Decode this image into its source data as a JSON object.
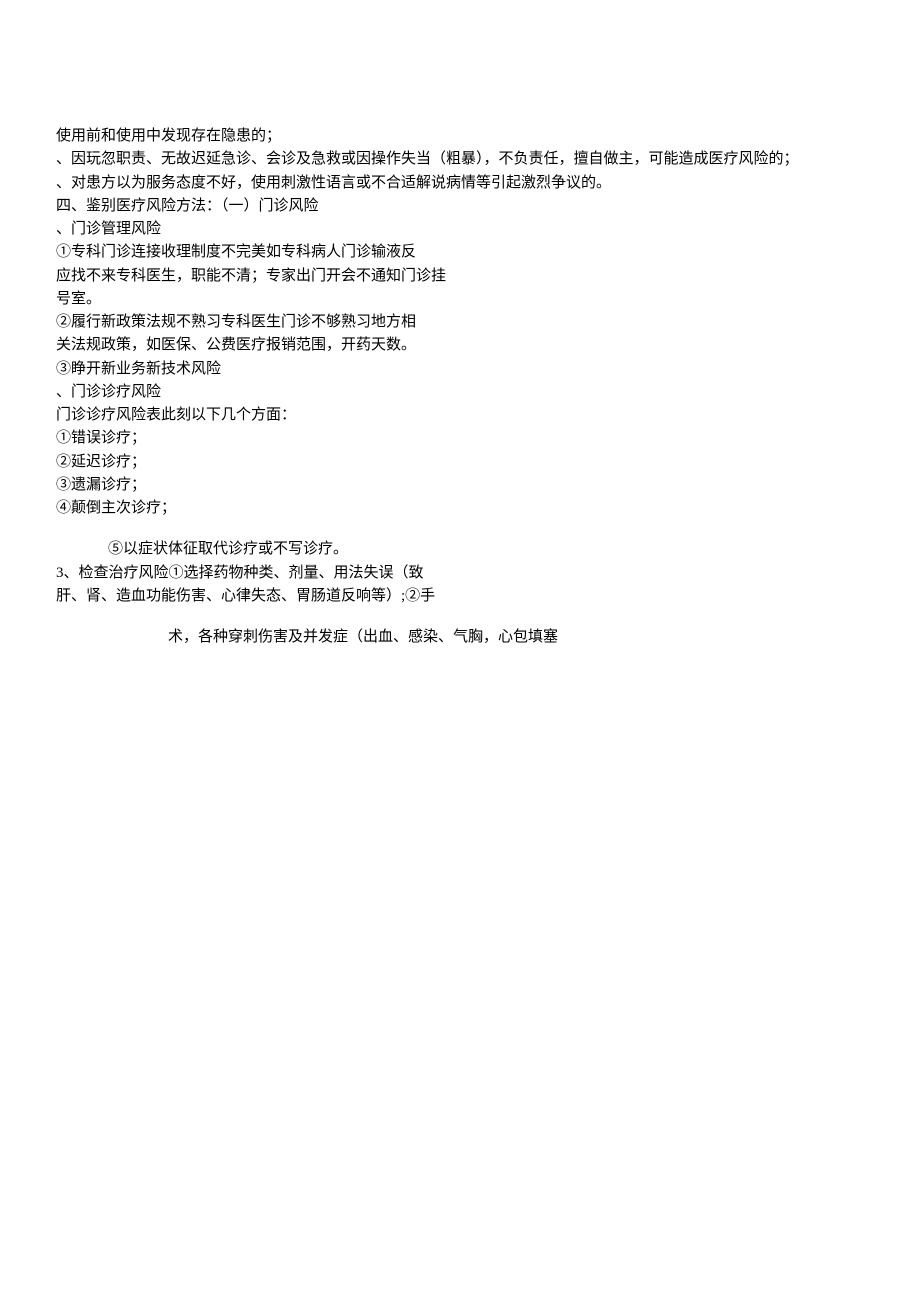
{
  "lines": {
    "l1": "使用前和使用中发现存在隐患的；",
    "l2": "、因玩忽职责、无故迟延急诊、会诊及急救或因操作失当（粗暴），不负责任，擅自做主，可能造成医疗风险的；",
    "l3": "、对患方以为服务态度不好，使用刺激性语言或不合适解说病情等引起激烈争议的。",
    "l4": "四、鉴别医疗风险方法：（一）门诊风险",
    "l5": "、门诊管理风险",
    "l6": "①专科门诊连接收理制度不完美如专科病人门诊输液反",
    "l7": "应找不来专科医生，职能不清；专家出门开会不通知门诊挂",
    "l8": "号室。",
    "l9": "②履行新政策法规不熟习专科医生门诊不够熟习地方相",
    "l10": "关法规政策，如医保、公费医疗报销范围，开药天数。",
    "l11": "③睁开新业务新技术风险",
    "l12": "、门诊诊疗风险",
    "l13": "门诊诊疗风险表此刻以下几个方面：",
    "l14": "①错误诊疗；",
    "l15": "②延迟诊疗；",
    "l16": "③遗漏诊疗；",
    "l17": "④颠倒主次诊疗；",
    "l18": "⑤以症状体征取代诊疗或不写诊疗。",
    "l19": "3、检查治疗风险①选择药物种类、剂量、用法失误（致",
    "l20": "肝、肾、造血功能伤害、心律失态、胃肠道反响等）;②手",
    "l21": "术，各种穿刺伤害及并发症（出血、感染、气胸，心包填塞"
  }
}
